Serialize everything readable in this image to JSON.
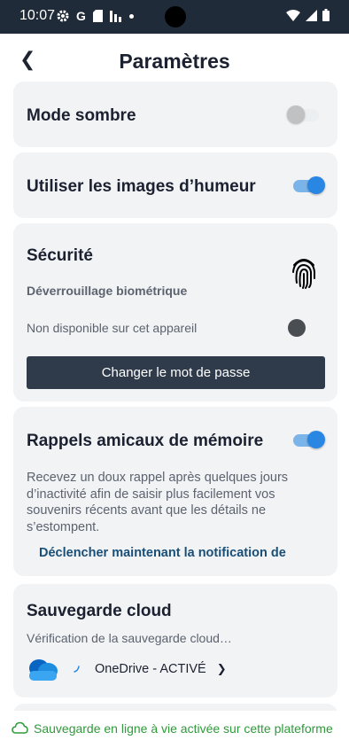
{
  "status_bar": {
    "time": "10:07",
    "left_icons": [
      "gear-icon",
      "google-icon",
      "sd-card-icon",
      "chart-icon",
      "dot-icon"
    ],
    "right_icons": [
      "wifi-icon",
      "signal-icon",
      "battery-icon"
    ]
  },
  "header": {
    "back_symbol": "❮",
    "title": "Paramètres"
  },
  "dark_mode": {
    "label": "Mode sombre",
    "enabled": false
  },
  "mood_images": {
    "label": "Utiliser les images d’humeur",
    "enabled": true
  },
  "security": {
    "title": "Sécurité",
    "biometric_label": "Déverrouillage biométrique",
    "unavailable_text": "Non disponible sur cet appareil",
    "biometric_enabled": false,
    "change_password": "Changer le mot de passe",
    "icon": "fingerprint-icon"
  },
  "reminders": {
    "title": "Rappels amicaux de mémoire",
    "enabled": true,
    "description": "Recevez un doux rappel après quelques jours d’inactivité afin de saisir plus facilement vos souvenirs récents avant que les détails ne s’estompent.",
    "trigger_link": "Déclencher maintenant la notification de"
  },
  "cloud": {
    "title": "Sauvegarde cloud",
    "status": "Vérification de la sauvegarde cloud…",
    "provider": "OneDrive - ACTIVÉ",
    "chevron": "❯",
    "icon": "onedrive-icon"
  },
  "footer": {
    "text": "Sauvegarde en ligne à vie activée sur cette plateforme",
    "icon": "cloud-icon"
  },
  "colors": {
    "accent": "#2a86e3",
    "dark_button": "#2f3b4b",
    "link": "#194e77",
    "success": "#2e9a3a",
    "card_bg": "#f2f3f5"
  }
}
